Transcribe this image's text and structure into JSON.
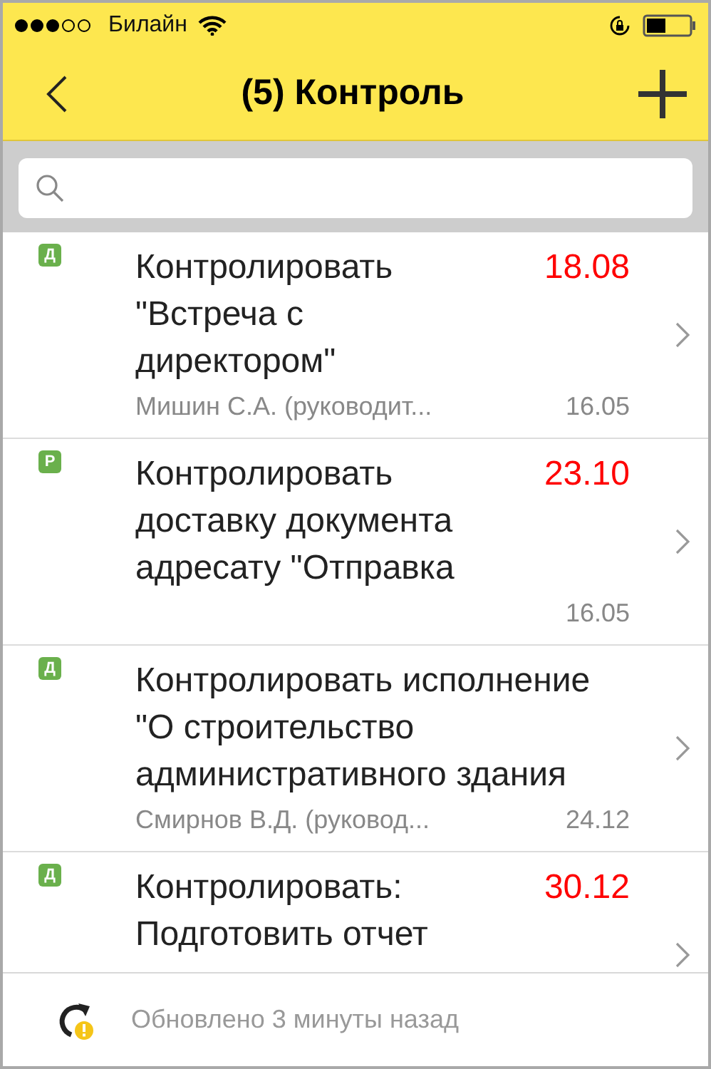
{
  "status_bar": {
    "carrier": "Билайн"
  },
  "header": {
    "title": "(5) Контроль"
  },
  "tasks": [
    {
      "badge": "Д",
      "title": "Контролировать \"Встреча с директором\"",
      "deadline": "18.08",
      "author": "Мишин С.А. (руководит...",
      "date": "16.05"
    },
    {
      "badge": "Р",
      "title": "Контролировать доставку документа адресату \"Отправка",
      "deadline": "23.10",
      "date": "16.05"
    },
    {
      "badge": "Д",
      "title": "Контролировать исполнение \"О строительство административного здания",
      "author": "Смирнов В.Д. (руковод...",
      "date": "24.12"
    },
    {
      "badge": "Д",
      "title": "Контролировать: Подготовить отчет",
      "deadline": "30.12"
    }
  ],
  "footer": {
    "text": "Обновлено 3 минуты назад"
  }
}
